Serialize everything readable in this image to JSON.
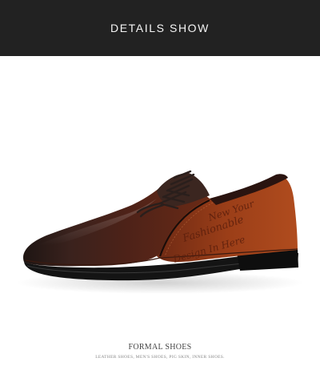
{
  "banner": {
    "title": "DETAILS SHOW"
  },
  "product": {
    "engraving": [
      "New Your",
      "Fashionable",
      "Design In Here"
    ]
  },
  "caption": {
    "title": "FORMAL SHOES",
    "subtitle": "LEATHER SHOES, MEN'S SHOES, PIG SKIN, INNER SHOES."
  },
  "colors": {
    "banner_bg": "#222222",
    "leather_dark": "#2a1a16",
    "leather_mid": "#5a2416",
    "leather_tan": "#a2441c",
    "sole": "#141414"
  }
}
